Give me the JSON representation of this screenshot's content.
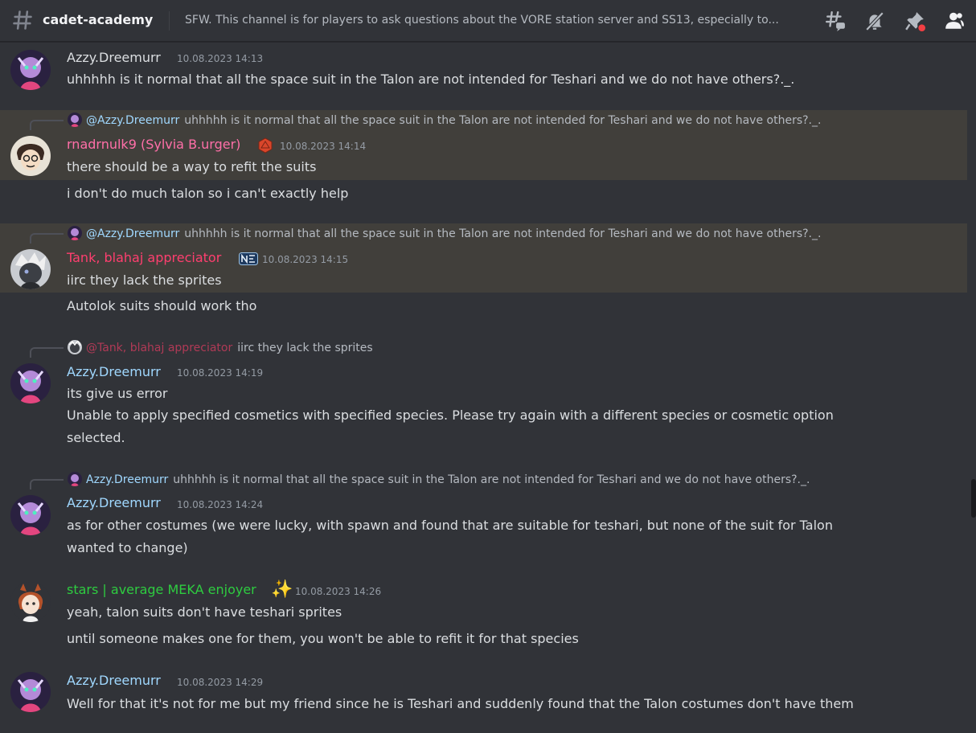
{
  "header": {
    "channel_name": "cadet-academy",
    "topic": "SFW. This channel is for players to ask questions about the VORE station server and SS13, especially to..."
  },
  "icons": {
    "channel": "hashtag-icon",
    "threads": "threads-icon",
    "mute": "bell-muted-icon",
    "pins": "pin-icon",
    "members": "members-icon"
  },
  "colors": {
    "azzy": "#a0d8ff",
    "sylvia": "#ff6fa8",
    "tank": "#ff3f6f",
    "stars": "#2ecc40",
    "background": "#313338",
    "highlight": "#413f3b"
  },
  "messages": [
    {
      "author": "Azzy.Dreemurr",
      "timestamp": "10.08.2023 14:13",
      "lines": [
        "uhhhhh is it normal that all the space suit in the Talon are not intended for Teshari and we do not have others?._."
      ]
    },
    {
      "reply": {
        "author": "@Azzy.Dreemurr",
        "text": "uhhhhh is it normal that all the space suit in the Talon are not intended for Teshari and we do not have others?._."
      },
      "author": "rnadrnulk9 (Sylvia B.urger)",
      "timestamp": "10.08.2023 14:14",
      "lines": [
        "there should be a way to refit the suits"
      ],
      "followup": "i don't do much talon so i can't exactly help"
    },
    {
      "reply": {
        "author": "@Azzy.Dreemurr",
        "text": "uhhhhh is it normal that all the space suit in the Talon are not intended for Teshari and we do not have others?._."
      },
      "author": "Tank, blahaj appreciator",
      "timestamp": "10.08.2023 14:15",
      "lines": [
        "iirc they lack the sprites"
      ],
      "followup": "Autolok suits should work tho"
    },
    {
      "reply": {
        "author": "@Tank, blahaj appreciator",
        "text": "iirc they lack the sprites"
      },
      "author": "Azzy.Dreemurr",
      "timestamp": "10.08.2023 14:19",
      "lines": [
        "its give us error",
        "Unable to apply specified cosmetics with specified species. Please try again with a different species or cosmetic option",
        "selected."
      ]
    },
    {
      "reply": {
        "author": "Azzy.Dreemurr",
        "text": "uhhhhh is it normal that all the space suit in the Talon are not intended for Teshari and we do not have others?._."
      },
      "author": "Azzy.Dreemurr",
      "timestamp": "10.08.2023 14:24",
      "lines": [
        "as for other costumes (we were lucky, with spawn and found that are suitable for teshari, but none of the suit for Talon",
        "wanted to change)"
      ]
    },
    {
      "author": "stars | average MEKA enjoyer",
      "timestamp": "10.08.2023 14:26",
      "lines": [
        "yeah, talon suits don't have teshari sprites"
      ],
      "followup": "until someone makes one for them, you won't be able to refit it for that species"
    },
    {
      "author": "Azzy.Dreemurr",
      "timestamp": "10.08.2023 14:29",
      "lines": [
        "Well for that it's not for me but my friend since he is Teshari and suddenly found that the Talon costumes don't have them"
      ]
    }
  ]
}
